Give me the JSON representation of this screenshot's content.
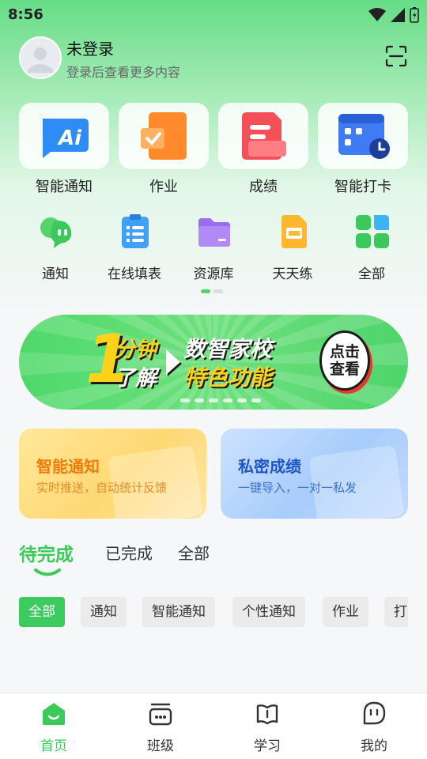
{
  "status_bar": {
    "time": "8:56"
  },
  "profile": {
    "name": "未登录",
    "subtitle": "登录后查看更多内容"
  },
  "big_apps": [
    {
      "label": "智能通知",
      "icon": "ai-notice-icon",
      "badge": "Ai"
    },
    {
      "label": "作业",
      "icon": "homework-icon"
    },
    {
      "label": "成绩",
      "icon": "grades-icon"
    },
    {
      "label": "智能打卡",
      "icon": "calendar-checkin-icon"
    }
  ],
  "small_apps": [
    {
      "label": "通知",
      "icon": "chat-bubble-icon"
    },
    {
      "label": "在线填表",
      "icon": "form-icon"
    },
    {
      "label": "资源库",
      "icon": "folder-icon"
    },
    {
      "label": "天天练",
      "icon": "practice-icon"
    },
    {
      "label": "全部",
      "icon": "grid-icon"
    }
  ],
  "banner": {
    "big_number": "1",
    "line1": "分钟",
    "line2": "了解",
    "line3": "数智家校",
    "line4": "特色功能",
    "button_line1": "点击",
    "button_line2": "查看"
  },
  "feature_cards": [
    {
      "title": "智能通知",
      "subtitle": "实时推送，自动统计反馈"
    },
    {
      "title": "私密成绩",
      "subtitle": "一键导入，一对一私发"
    }
  ],
  "tabs": [
    {
      "label": "待完成",
      "active": true
    },
    {
      "label": "已完成",
      "active": false
    },
    {
      "label": "全部",
      "active": false
    }
  ],
  "chips": [
    {
      "label": "全部",
      "active": true
    },
    {
      "label": "通知",
      "active": false
    },
    {
      "label": "智能通知",
      "active": false
    },
    {
      "label": "个性通知",
      "active": false
    },
    {
      "label": "作业",
      "active": false
    },
    {
      "label": "打",
      "active": false
    }
  ],
  "bottom_nav": [
    {
      "label": "首页",
      "icon": "home-icon",
      "active": true
    },
    {
      "label": "班级",
      "icon": "class-icon",
      "active": false
    },
    {
      "label": "学习",
      "icon": "study-icon",
      "active": false
    },
    {
      "label": "我的",
      "icon": "profile-icon",
      "active": false
    }
  ],
  "colors": {
    "primary": "#3cc95c",
    "accent_orange": "#f07c0c",
    "accent_blue": "#1f56c7"
  }
}
